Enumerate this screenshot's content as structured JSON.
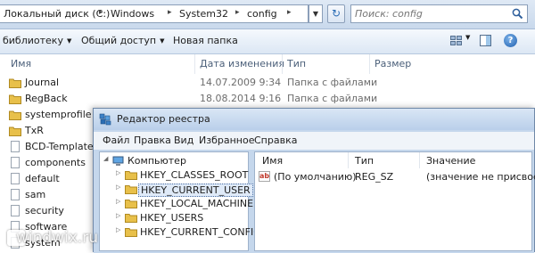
{
  "explorer": {
    "breadcrumb": [
      "Локальный диск (C:)",
      "Windows",
      "System32",
      "config"
    ],
    "search_placeholder": "Поиск: config",
    "toolbar": {
      "library_label": "библиотеку",
      "share_label": "Общий доступ",
      "new_folder_label": "Новая папка"
    },
    "columns": {
      "name": "Имя",
      "date": "Дата изменения",
      "type": "Тип",
      "size": "Размер"
    },
    "files": [
      {
        "name": "Journal",
        "date": "14.07.2009 9:34",
        "type": "Папка с файлами",
        "kind": "folder"
      },
      {
        "name": "RegBack",
        "date": "18.08.2014 9:16",
        "type": "Папка с файлами",
        "kind": "folder"
      },
      {
        "name": "systemprofile",
        "date": "",
        "type": "",
        "kind": "folder"
      },
      {
        "name": "TxR",
        "date": "",
        "type": "",
        "kind": "folder"
      },
      {
        "name": "BCD-Template",
        "date": "",
        "type": "",
        "kind": "file"
      },
      {
        "name": "components",
        "date": "",
        "type": "",
        "kind": "file"
      },
      {
        "name": "default",
        "date": "",
        "type": "",
        "kind": "file"
      },
      {
        "name": "sam",
        "date": "",
        "type": "",
        "kind": "file"
      },
      {
        "name": "security",
        "date": "",
        "type": "",
        "kind": "file"
      },
      {
        "name": "software",
        "date": "",
        "type": "",
        "kind": "file"
      },
      {
        "name": "system",
        "date": "",
        "type": "",
        "kind": "file"
      }
    ]
  },
  "regedit": {
    "title": "Редактор реестра",
    "menu": [
      "Файл",
      "Правка",
      "Вид",
      "Избранное",
      "Справка"
    ],
    "tree": {
      "root": "Компьютер",
      "keys": [
        "HKEY_CLASSES_ROOT",
        "HKEY_CURRENT_USER",
        "HKEY_LOCAL_MACHINE",
        "HKEY_USERS",
        "HKEY_CURRENT_CONFIG"
      ],
      "selected": "HKEY_CURRENT_USER"
    },
    "values": {
      "headers": {
        "name": "Имя",
        "type": "Тип",
        "value": "Значение"
      },
      "rows": [
        {
          "name": "(По умолчанию)",
          "type": "REG_SZ",
          "value": "(значение не присвоено)"
        }
      ]
    }
  },
  "watermark": "windwix.ru",
  "colors": {
    "folder": "#e8c04a",
    "window_frame": "#c5d7ec",
    "selection": "#dfeaf8"
  }
}
